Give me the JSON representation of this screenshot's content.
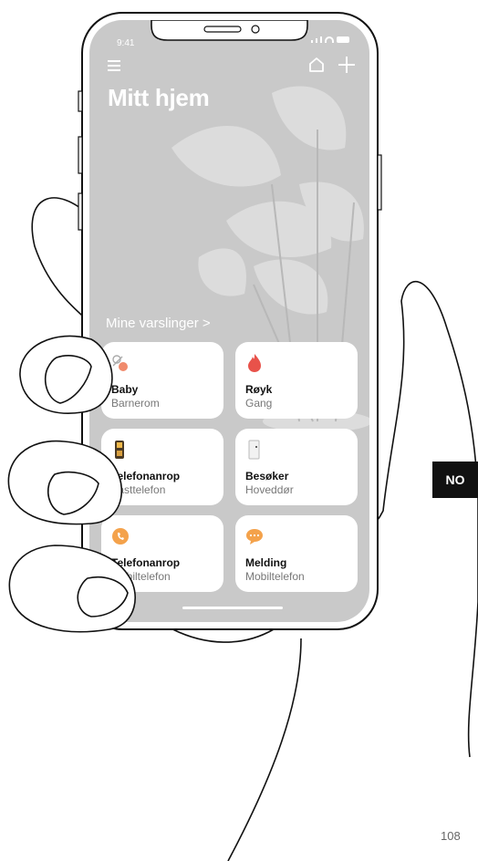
{
  "status": {
    "time": "9:41"
  },
  "header": {
    "title": "Mitt hjem",
    "menu_icon": "menu-icon",
    "home_icon": "home-icon",
    "add_icon": "plus-icon"
  },
  "notifications": {
    "link": "Mine varslinger >",
    "cards": [
      {
        "name": "Baby",
        "location": "Barnerom",
        "icon": "pacifier-icon"
      },
      {
        "name": "Røyk",
        "location": "Gang",
        "icon": "flame-icon"
      },
      {
        "name": "Telefonanrop",
        "location": "Fasttelefon",
        "icon": "landline-phone-icon"
      },
      {
        "name": "Besøker",
        "location": "Hoveddør",
        "icon": "door-icon"
      },
      {
        "name": "Telefonanrop",
        "location": "Mobiltelefon",
        "icon": "phone-call-icon"
      },
      {
        "name": "Melding",
        "location": "Mobiltelefon",
        "icon": "chat-bubble-icon"
      }
    ]
  },
  "page": {
    "language": "NO",
    "number": "108"
  },
  "colors": {
    "screen_bg": "#c9c9c9",
    "card_bg": "#ffffff",
    "accent_red": "#e8524a",
    "accent_orange": "#f4a24b"
  }
}
